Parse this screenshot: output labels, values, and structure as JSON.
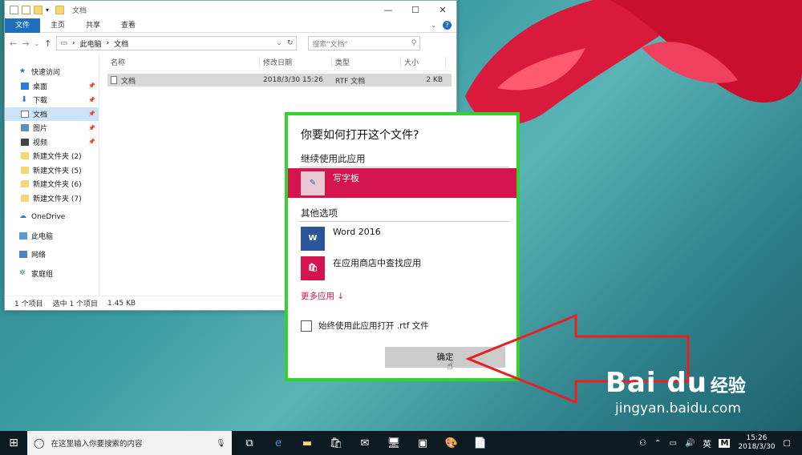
{
  "explorer": {
    "title": "文档",
    "ribbon_tabs": [
      "文件",
      "主页",
      "共享",
      "查看"
    ],
    "breadcrumb": [
      "此电脑",
      "文档"
    ],
    "search_placeholder": "搜索\"文档\"",
    "nav_items": [
      {
        "label": "快速访问",
        "icon": "star-icon"
      },
      {
        "label": "桌面",
        "icon": "desktop-icon"
      },
      {
        "label": "下载",
        "icon": "download-icon"
      },
      {
        "label": "文档",
        "icon": "document-icon"
      },
      {
        "label": "图片",
        "icon": "picture-icon"
      },
      {
        "label": "视频",
        "icon": "video-icon"
      },
      {
        "label": "新建文件夹 (2)",
        "icon": "folder-icon"
      },
      {
        "label": "新建文件夹 (5)",
        "icon": "folder-icon"
      },
      {
        "label": "新建文件夹 (6)",
        "icon": "folder-icon"
      },
      {
        "label": "新建文件夹 (7)",
        "icon": "folder-icon"
      },
      {
        "label": "OneDrive",
        "icon": "cloud-icon"
      },
      {
        "label": "此电脑",
        "icon": "computer-icon"
      },
      {
        "label": "网络",
        "icon": "network-icon"
      },
      {
        "label": "家庭组",
        "icon": "homegroup-icon"
      }
    ],
    "columns": [
      "名称",
      "修改日期",
      "类型",
      "大小"
    ],
    "files": [
      {
        "name": "文档",
        "modified": "2018/3/30 15:26",
        "type": "RTF 文档",
        "size": "2 KB"
      }
    ],
    "status": {
      "count": "1 个项目",
      "selected": "选中 1 个项目",
      "size": "1.45 KB"
    }
  },
  "dialog": {
    "question": "你要如何打开这个文件?",
    "continue_section": "继续使用此应用",
    "current_app": "写字板",
    "other_section": "其他选项",
    "other_apps": [
      "Word 2016",
      "在应用商店中查找应用"
    ],
    "more_apps": "更多应用 ↓",
    "always_use": "始终使用此应用打开 .rtf 文件",
    "ok": "确定"
  },
  "watermark": {
    "logo": "Bai du",
    "brand": "经验",
    "url": "jingyan.baidu.com"
  },
  "taskbar": {
    "search_placeholder": "在这里输入你要搜索的内容",
    "ime": "英",
    "ime_mode": "M",
    "time": "15:26",
    "date": "2018/3/30"
  },
  "colors": {
    "accent": "#d4144e",
    "highlight_border": "#35d22e",
    "arrow": "#e82020",
    "explorer_blue": "#1f6fbd"
  }
}
